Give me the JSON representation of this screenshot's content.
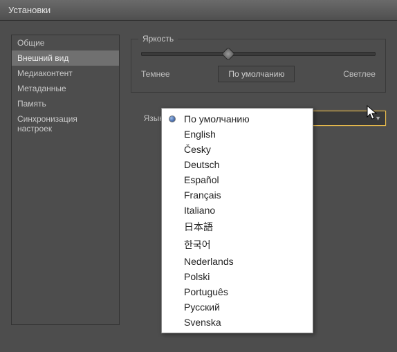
{
  "window": {
    "title": "Установки"
  },
  "sidebar": {
    "items": [
      {
        "label": "Общие"
      },
      {
        "label": "Внешний вид"
      },
      {
        "label": "Медиаконтент"
      },
      {
        "label": "Метаданные"
      },
      {
        "label": "Память"
      },
      {
        "label": "Синхронизация настроек"
      }
    ],
    "selected_index": 1
  },
  "brightness": {
    "legend": "Яркость",
    "darker": "Темнее",
    "default_btn": "По умолчанию",
    "lighter": "Светлее"
  },
  "language": {
    "label": "Язык:",
    "selected": "По умолчанию",
    "options": [
      "По умолчанию",
      "English",
      "Česky",
      "Deutsch",
      "Español",
      "Français",
      "Italiano",
      "日本語",
      "한국어",
      "Nederlands",
      "Polski",
      "Português",
      "Русский",
      "Svenska"
    ],
    "selected_option_index": 0
  }
}
